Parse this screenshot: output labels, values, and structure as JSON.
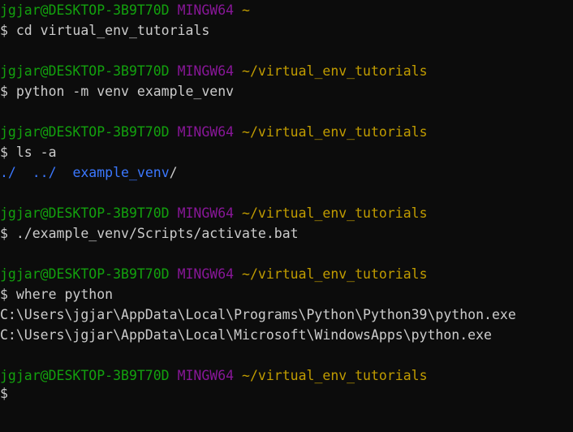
{
  "terminal": {
    "prompt_user": "jgjar@DESKTOP-3B9T70D",
    "prompt_env": "MINGW64",
    "prompt_symbol": "$",
    "blocks": [
      {
        "path": "~",
        "command": "cd virtual_env_tutorials"
      },
      {
        "path": "~/virtual_env_tutorials",
        "command": "python -m venv example_venv"
      },
      {
        "path": "~/virtual_env_tutorials",
        "command": "ls -a",
        "output": {
          "item1": "./",
          "item2": "../",
          "item3": "example_venv",
          "item3_slash": "/"
        }
      },
      {
        "path": "~/virtual_env_tutorials",
        "command": "./example_venv/Scripts/activate.bat"
      },
      {
        "path": "~/virtual_env_tutorials",
        "command": "where python",
        "output_lines": [
          "C:\\Users\\jgjar\\AppData\\Local\\Programs\\Python\\Python39\\python.exe",
          "C:\\Users\\jgjar\\AppData\\Local\\Microsoft\\WindowsApps\\python.exe"
        ]
      },
      {
        "path": "~/virtual_env_tutorials",
        "command": ""
      }
    ]
  },
  "colors": {
    "background": "#0c0c0c",
    "text": "#cccccc",
    "user": "#13a10e",
    "env": "#881798",
    "path": "#c19c00",
    "directory": "#3b78ff"
  }
}
